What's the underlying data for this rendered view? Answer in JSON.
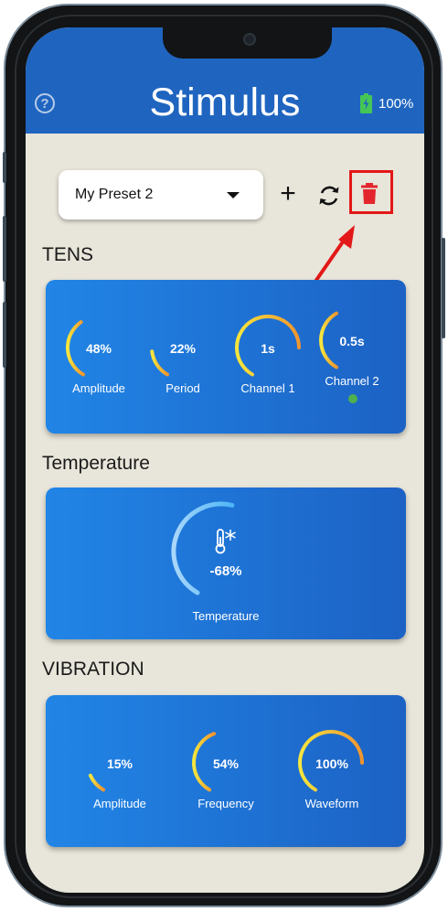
{
  "header": {
    "title": "Stimulus",
    "battery": "100%",
    "help_glyph": "?"
  },
  "toolbar": {
    "preset": "My Preset 2",
    "add_glyph": "+",
    "icons": [
      "sync-icon",
      "trash-icon",
      "chevron-down-icon"
    ]
  },
  "sections": {
    "tens": "TENS",
    "temperature": "Temperature",
    "vibration": "VIBRATION"
  },
  "tens": {
    "amplitude": {
      "value": "48%",
      "label": "Amplitude",
      "level": 0.48
    },
    "period": {
      "value": "22%",
      "label": "Period",
      "level": 0.22
    },
    "channel1": {
      "value": "1s",
      "label": "Channel 1",
      "level": 1.0
    },
    "channel2": {
      "value": "0.5s",
      "label": "Channel 2",
      "level": 0.5
    }
  },
  "temperature": {
    "value": "-68%",
    "label": "Temperature",
    "level": 0.68
  },
  "vibration": {
    "amplitude": {
      "value": "15%",
      "label": "Amplitude",
      "level": 0.15
    },
    "frequency": {
      "value": "54%",
      "label": "Frequency",
      "level": 0.54
    },
    "waveform": {
      "value": "100%",
      "label": "Waveform",
      "level": 1.0
    }
  },
  "colors": {
    "header": "#1f65c0",
    "background": "#e8e5da",
    "card": "#1f70d4",
    "accent_red": "#e31818",
    "arc_start": "#f6e63d",
    "arc_end": "#f1952f",
    "temp_arc": "#a9d7fb",
    "battery": "#45c657",
    "status_dot": "#4fb04f"
  }
}
